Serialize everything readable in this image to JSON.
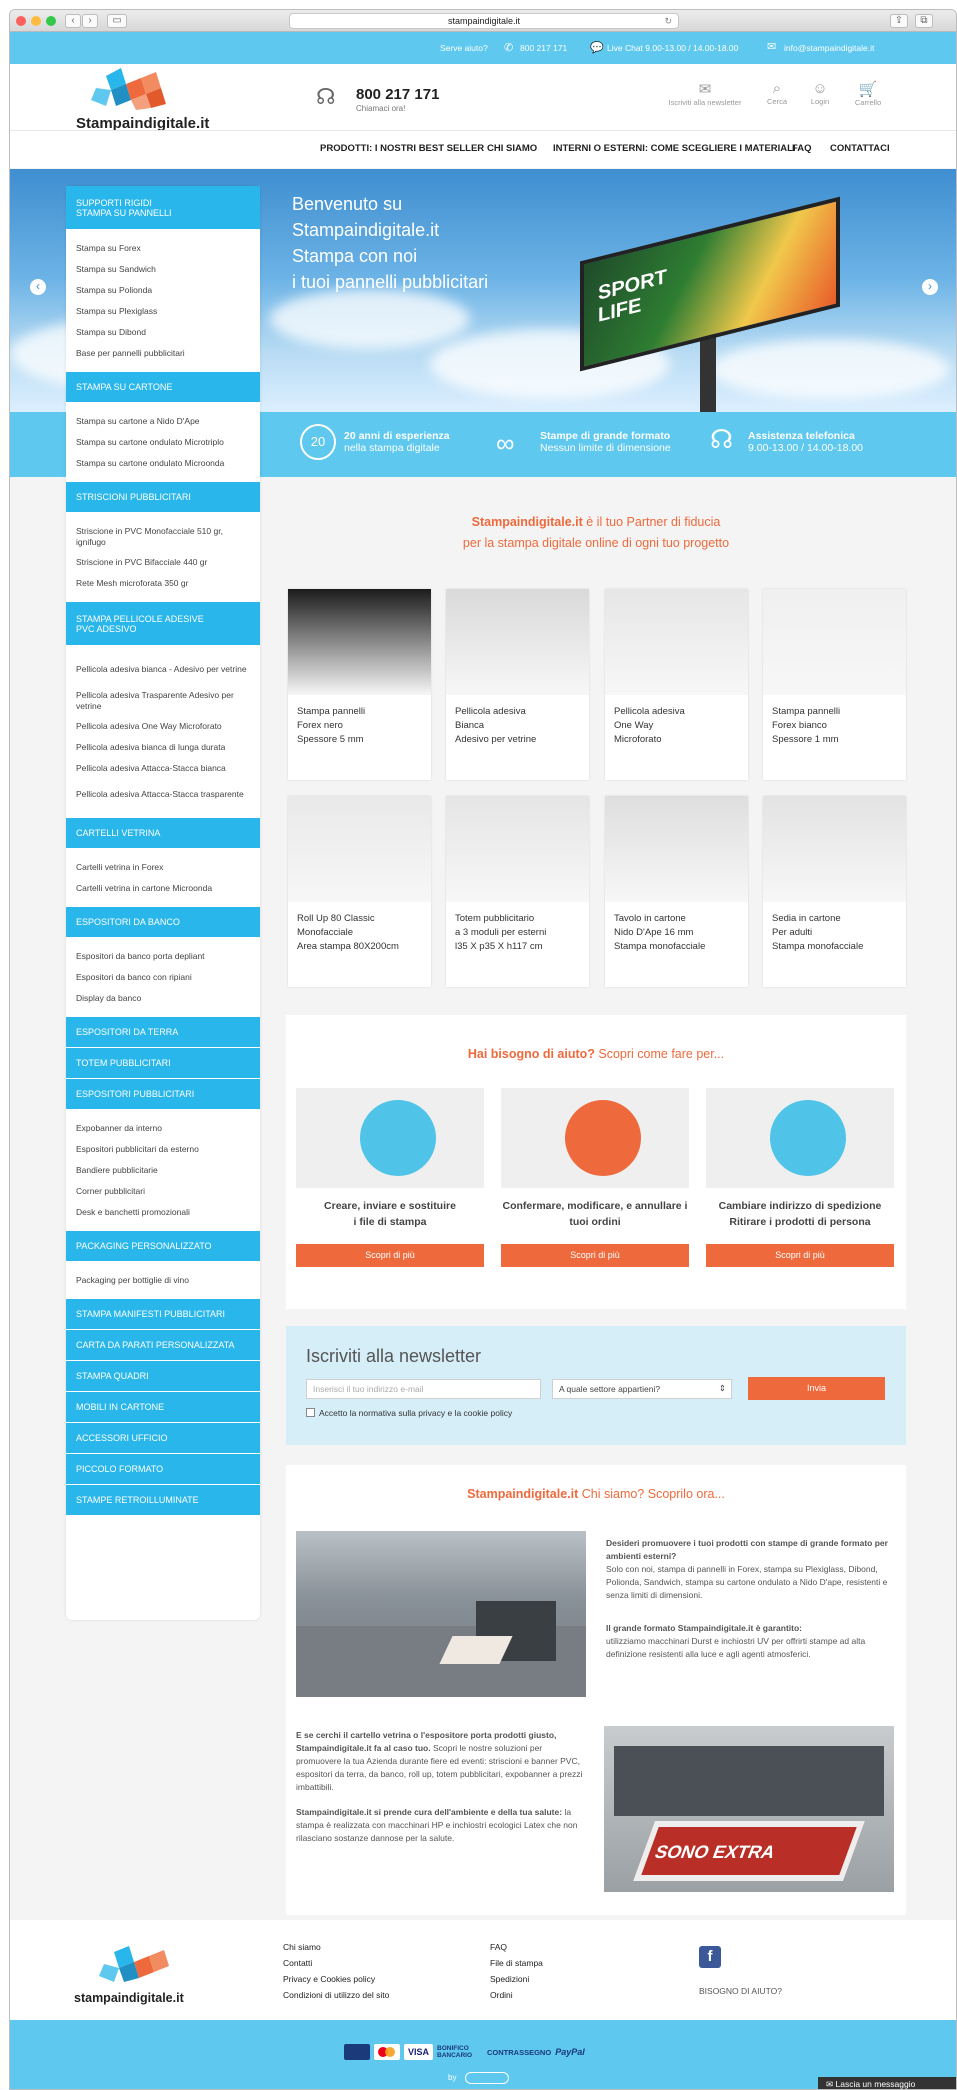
{
  "browser": {
    "url": "stampaindigitale.it"
  },
  "topbar": {
    "help": "Serve aiuto?",
    "phone": "800 217 171",
    "chat": "Live Chat 9.00-13.00 / 14.00-18.00",
    "email": "info@stampaindigitale.it"
  },
  "header": {
    "logo": "Stampaindigitale.it",
    "phone": "800 217 171",
    "phone_sub": "Chiamaci ora!",
    "icons": {
      "newsletter": "Iscriviti alla newsletter",
      "search": "Cerca",
      "login": "Login",
      "cart": "Carrello"
    }
  },
  "menu": [
    "PRODOTTI: I NOSTRI BEST SELLER",
    "CHI SIAMO",
    "INTERNI O ESTERNI: COME SCEGLIERE I MATERIALI",
    "FAQ",
    "CONTATTACI"
  ],
  "hero": {
    "line1": "Benvenuto su",
    "line2": "Stampaindigitale.it",
    "line3": "Stampa con noi",
    "line4": "i tuoi pannelli pubblicitari",
    "billboard": "SPORT LIFE"
  },
  "features": [
    {
      "title": "20 anni di esperienza",
      "sub": "nella stampa digitale",
      "badge": "20"
    },
    {
      "title": "Stampe di grande formato",
      "sub": "Nessun limite di dimensione"
    },
    {
      "title": "Assistenza telefonica",
      "sub": "9.00-13.00 / 14.00-18.00"
    }
  ],
  "sidebar": [
    {
      "head": [
        "SUPPORTI RIGIDI",
        "STAMPA SU PANNELLI"
      ],
      "items": [
        "Stampa su Forex",
        "Stampa su Sandwich",
        "Stampa su Polionda",
        "Stampa su Plexiglass",
        "Stampa su Dibond",
        "Base per pannelli pubblicitari"
      ]
    },
    {
      "head": [
        "STAMPA SU CARTONE"
      ],
      "items": [
        "Stampa su cartone a Nido D'Ape",
        "Stampa su cartone ondulato Microtriplo",
        "Stampa su cartone ondulato Microonda"
      ]
    },
    {
      "head": [
        "STRISCIONI PUBBLICITARI"
      ],
      "items": [
        "Striscione in PVC Monofacciale 510 gr, ignifugo",
        "Striscione in PVC Bifacciale 440 gr",
        "Rete Mesh microforata 350 gr"
      ]
    },
    {
      "head": [
        "STAMPA PELLICOLE ADESIVE",
        "PVC ADESIVO"
      ],
      "items": [
        "Pellicola adesiva bianca - Adesivo per vetrine",
        "Pellicola adesiva Trasparente Adesivo per vetrine",
        "Pellicola adesiva One Way Microforato",
        "Pellicola adesiva bianca di lunga durata",
        "Pellicola adesiva Attacca-Stacca bianca",
        "Pellicola adesiva Attacca-Stacca trasparente"
      ]
    },
    {
      "head": [
        "CARTELLI VETRINA"
      ],
      "items": [
        "Cartelli vetrina in Forex",
        "Cartelli vetrina in cartone Microonda"
      ]
    },
    {
      "head": [
        "ESPOSITORI DA BANCO"
      ],
      "items": [
        "Espositori da banco porta depliant",
        "Espositori da banco con ripiani",
        "Display da banco"
      ]
    },
    {
      "head": [
        "ESPOSITORI DA TERRA"
      ],
      "items": []
    },
    {
      "head": [
        "TOTEM PUBBLICITARI"
      ],
      "items": []
    },
    {
      "head": [
        "ESPOSITORI PUBBLICITARI"
      ],
      "items": [
        "Expobanner da interno",
        "Espositori pubblicitari da esterno",
        "Bandiere pubblicitarie",
        "Corner pubblicitari",
        "Desk e banchetti promozionali"
      ]
    },
    {
      "head": [
        "PACKAGING PERSONALIZZATO"
      ],
      "items": [
        "Packaging per bottiglie di vino"
      ]
    },
    {
      "head": [
        "STAMPA MANIFESTI PUBBLICITARI"
      ],
      "items": []
    },
    {
      "head": [
        "CARTA DA PARATI PERSONALIZZATA"
      ],
      "items": []
    },
    {
      "head": [
        "STAMPA QUADRI"
      ],
      "items": []
    },
    {
      "head": [
        "MOBILI IN CARTONE"
      ],
      "items": []
    },
    {
      "head": [
        "ACCESSORI UFFICIO"
      ],
      "items": []
    },
    {
      "head": [
        "PICCOLO FORMATO"
      ],
      "items": []
    },
    {
      "head": [
        "STAMPE RETROILLUMINATE"
      ],
      "items": []
    }
  ],
  "intro": {
    "brand": "Stampaindigitale.it",
    "line1": " è il tuo Partner di fiducia",
    "line2": "per la stampa digitale online di ogni tuo progetto"
  },
  "products": [
    {
      "l1": "Stampa pannelli",
      "l2": "Forex nero",
      "l3": "Spessore 5 mm"
    },
    {
      "l1": "Pellicola adesiva",
      "l2": "Bianca",
      "l3": "Adesivo per vetrine"
    },
    {
      "l1": "Pellicola adesiva",
      "l2": "One Way",
      "l3": "Microforato"
    },
    {
      "l1": "Stampa pannelli",
      "l2": "Forex bianco",
      "l3": "Spessore 1 mm"
    },
    {
      "l1": "Roll Up 80 Classic",
      "l2": "Monofacciale",
      "l3": "Area stampa 80X200cm"
    },
    {
      "l1": "Totem pubblicitario",
      "l2": "a 3 moduli per esterni",
      "l3": "l35 X p35 X h117 cm"
    },
    {
      "l1": "Tavolo in cartone",
      "l2": "Nido D'Ape 16 mm",
      "l3": "Stampa monofacciale"
    },
    {
      "l1": "Sedia in cartone",
      "l2": "Per adulti",
      "l3": "Stampa monofacciale"
    }
  ],
  "help": {
    "title_a": "Hai bisogno di aiuto?",
    "title_b": " Scopri come fare per...",
    "items": [
      {
        "l1": "Creare, inviare e sostituire",
        "l2": "i file di stampa",
        "btn": "Scopri di più"
      },
      {
        "l1": "Confermare, modificare, e annullare i",
        "l2": "tuoi ordini",
        "btn": "Scopri di più"
      },
      {
        "l1": "Cambiare indirizzo di spedizione",
        "l2": "Ritirare i prodotti di persona",
        "btn": "Scopri di più"
      }
    ]
  },
  "newsletter": {
    "title": "Iscriviti alla newsletter",
    "email_placeholder": "Inserisci il tuo indirizzo e-mail",
    "sector": "A quale settore appartieni?",
    "submit": "Invia",
    "privacy": "Accetto la normativa sulla privacy e la cookie policy"
  },
  "about": {
    "title_a": "Stampaindigitale.it",
    "title_b": " Chi siamo? Scoprilo ora...",
    "p1_bold": "Desideri promuovere i tuoi prodotti con stampe di grande formato per ambienti esterni?",
    "p1": "Solo con noi, stampa di pannelli in Forex, stampa su Plexiglass, Dibond, Polionda, Sandwich, stampa su cartone ondulato a Nido D'ape, resistenti e senza limiti di dimensioni.",
    "p2_bold": "Il grande formato Stampaindigitale.it è garantito:",
    "p2": "utilizziamo macchinari Durst e inchiostri UV per offrirti stampe ad alta definizione resistenti alla luce e agli agenti atmosferici.",
    "p3_bold": "E se cerchi il cartello vetrina o l'espositore porta prodotti giusto, Stampaindigitale.it fa al caso tuo.",
    "p3": " Scopri le nostre soluzioni per promuovere la tua Azienda durante fiere ed eventi: striscioni e banner PVC, espositori da terra, da banco, roll up, totem pubblicitari, expobanner a prezzi imbattibili.",
    "p4_bold": "Stampaindigitale.it si prende cura dell'ambiente e della tua salute:",
    "p4": " la stampa è realizzata con macchinari HP e inchiostri ecologici Latex che non rilasciano sostanze dannose per la salute.",
    "floor_sign": "SONO EXTRA"
  },
  "footer": {
    "logo": "stampaindigitale.it",
    "col1": [
      "Chi siamo",
      "Contatti",
      "Privacy e Cookies policy",
      "Condizioni di utilizzo del sito"
    ],
    "col2": [
      "FAQ",
      "File di stampa",
      "Spedizioni",
      "Ordini"
    ],
    "help": "BISOGNO DI AIUTO?",
    "facebook": "f"
  },
  "payments": [
    "VISA",
    "BONIFICO BANCARIO",
    "CONTRASSEGNO",
    "PayPal"
  ],
  "by": "by",
  "chat_tab": "Lascia un messaggio",
  "colors": {
    "accent": "#29b6ea",
    "orange": "#ee6a3d",
    "light": "#5ec8ef"
  }
}
